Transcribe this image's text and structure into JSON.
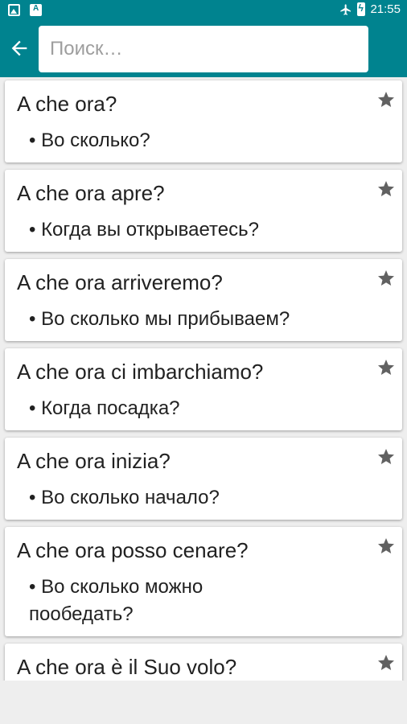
{
  "status_bar": {
    "time": "21:55",
    "left_icons": [
      "image-icon",
      "text-icon"
    ],
    "right_icons": [
      "airplane-icon",
      "battery-icon"
    ]
  },
  "toolbar": {
    "back_icon": "arrow-left-icon",
    "search_placeholder": "Поиск…",
    "search_value": ""
  },
  "colors": {
    "primary": "#00838f",
    "background": "#eeeeee",
    "card": "#ffffff",
    "star": "#616161"
  },
  "phrases": [
    {
      "italian": "A che ora?",
      "russian": "Во сколько?"
    },
    {
      "italian": "A che ora apre?",
      "russian": "Когда вы открываетесь?"
    },
    {
      "italian": "A che ora arriveremo?",
      "russian": "Во сколько мы прибываем?"
    },
    {
      "italian": "A che ora ci imbarchiamo?",
      "russian": "Когда посадка?"
    },
    {
      "italian": "A che ora inizia?",
      "russian": "Во сколько начало?"
    },
    {
      "italian": "A che ora posso cenare?",
      "russian": "Во сколько можно пообедать?"
    },
    {
      "italian": "A che ora è il Suo volo?",
      "russian": ""
    }
  ]
}
